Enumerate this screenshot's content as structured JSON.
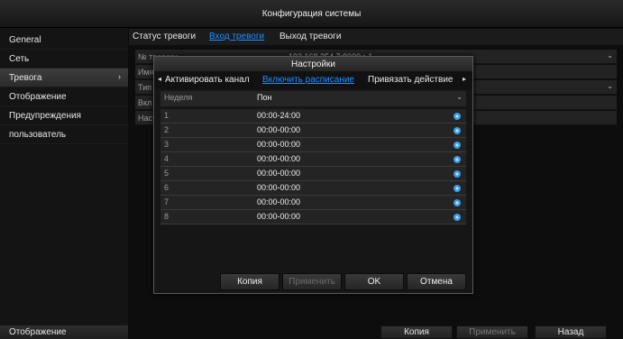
{
  "window": {
    "title": "Конфигурация системы"
  },
  "sidebar": {
    "items": [
      {
        "label": "General"
      },
      {
        "label": "Сеть"
      },
      {
        "label": "Тревога",
        "arrow": "›"
      },
      {
        "label": "Отображение"
      },
      {
        "label": "Предупреждения"
      },
      {
        "label": "пользователь"
      }
    ],
    "bottom_label": "Отображение"
  },
  "main": {
    "tabs": [
      {
        "label": "Статус тревоги"
      },
      {
        "label": "Вход тревоги"
      },
      {
        "label": "Выход тревоги"
      }
    ],
    "rows": [
      {
        "label": "№ тревоги",
        "value": "192.168.254.7:8000<-1"
      },
      {
        "label": "Имя",
        "value": ""
      },
      {
        "label": "Тип",
        "value": ""
      },
      {
        "label": "Вкл",
        "value": ""
      },
      {
        "label": "Настройки",
        "value": ""
      }
    ],
    "buttons": {
      "copy": "Копия",
      "apply": "Применить",
      "back": "Назад"
    }
  },
  "dialog": {
    "title": "Настройки",
    "tabs": [
      {
        "label": "Активировать канал"
      },
      {
        "label": "Включить расписание"
      },
      {
        "label": "Привязать действие"
      }
    ],
    "arrow_left": "◂",
    "arrow_right": "▸",
    "week": {
      "label": "Неделя",
      "value": "Пон"
    },
    "schedule": [
      {
        "num": "1",
        "time": "00:00-24:00"
      },
      {
        "num": "2",
        "time": "00:00-00:00"
      },
      {
        "num": "3",
        "time": "00:00-00:00"
      },
      {
        "num": "4",
        "time": "00:00-00:00"
      },
      {
        "num": "5",
        "time": "00:00-00:00"
      },
      {
        "num": "6",
        "time": "00:00-00:00"
      },
      {
        "num": "7",
        "time": "00:00-00:00"
      },
      {
        "num": "8",
        "time": "00:00-00:00"
      }
    ],
    "buttons": {
      "copy": "Копия",
      "apply": "Применить",
      "ok": "OK",
      "cancel": "Отмена"
    }
  },
  "colors": {
    "accent": "#1e90ff",
    "background": "#0b0b0b",
    "schedule_icon": "#3b9be8"
  },
  "icons": {
    "chevron": "chevron-down-icon",
    "schedule": "gear-icon"
  }
}
